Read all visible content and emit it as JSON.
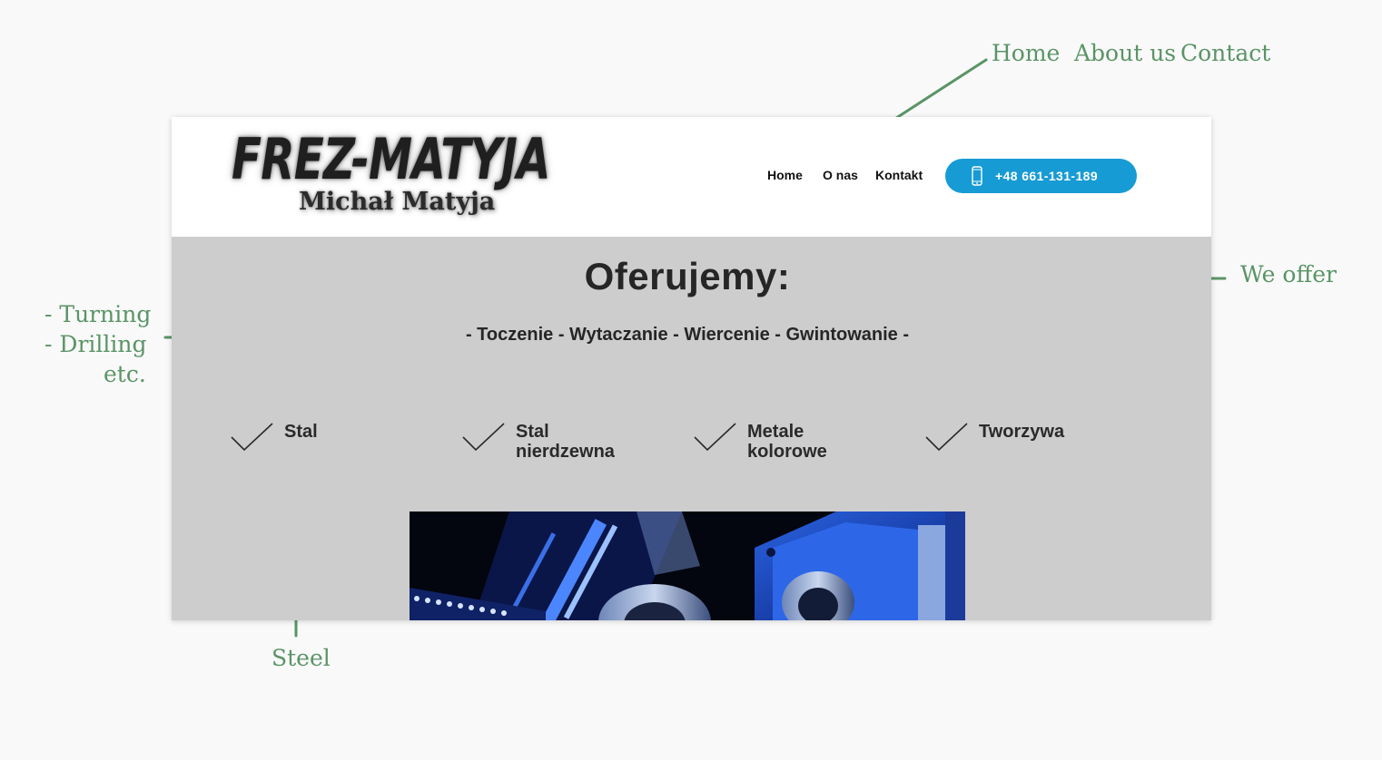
{
  "annotations": {
    "nav_home": "Home",
    "nav_about": "About us",
    "nav_contact": "Contact",
    "we_offer": "We offer",
    "turning": "- Turning",
    "drilling": "- Drilling",
    "etc": "etc.",
    "steel": "Steel"
  },
  "site": {
    "logo": {
      "main": "FREZ-MATYJA",
      "sub": "Michał Matyja"
    },
    "nav": {
      "home": "Home",
      "about": "O nas",
      "contact": "Kontakt"
    },
    "phone": {
      "label": "+48 661-131-189",
      "icon": "phone-icon"
    },
    "offer": {
      "title": "Oferujemy:",
      "services": "- Toczenie - Wytaczanie - Wiercenie - Gwintowanie -"
    },
    "materials": [
      {
        "label": "Stal",
        "icon": "checkmark-icon"
      },
      {
        "label": "Stal\nnierdzewna",
        "icon": "checkmark-icon"
      },
      {
        "label": "Metale\nkolorowe",
        "icon": "checkmark-icon"
      },
      {
        "label": "Tworzywa",
        "icon": "checkmark-icon"
      }
    ],
    "photo": "cnc-machine-photo"
  },
  "colors": {
    "annotation": "#5a9466",
    "accent_button": "#179bd4",
    "content_bg": "#cdcdcd",
    "page_bg": "#f9f9f9"
  }
}
